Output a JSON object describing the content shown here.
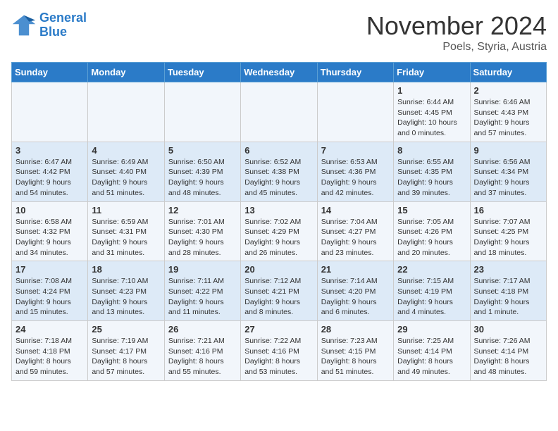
{
  "logo": {
    "line1": "General",
    "line2": "Blue"
  },
  "title": "November 2024",
  "subtitle": "Poels, Styria, Austria",
  "days_of_week": [
    "Sunday",
    "Monday",
    "Tuesday",
    "Wednesday",
    "Thursday",
    "Friday",
    "Saturday"
  ],
  "weeks": [
    [
      {
        "day": "",
        "info": ""
      },
      {
        "day": "",
        "info": ""
      },
      {
        "day": "",
        "info": ""
      },
      {
        "day": "",
        "info": ""
      },
      {
        "day": "",
        "info": ""
      },
      {
        "day": "1",
        "info": "Sunrise: 6:44 AM\nSunset: 4:45 PM\nDaylight: 10 hours and 0 minutes."
      },
      {
        "day": "2",
        "info": "Sunrise: 6:46 AM\nSunset: 4:43 PM\nDaylight: 9 hours and 57 minutes."
      }
    ],
    [
      {
        "day": "3",
        "info": "Sunrise: 6:47 AM\nSunset: 4:42 PM\nDaylight: 9 hours and 54 minutes."
      },
      {
        "day": "4",
        "info": "Sunrise: 6:49 AM\nSunset: 4:40 PM\nDaylight: 9 hours and 51 minutes."
      },
      {
        "day": "5",
        "info": "Sunrise: 6:50 AM\nSunset: 4:39 PM\nDaylight: 9 hours and 48 minutes."
      },
      {
        "day": "6",
        "info": "Sunrise: 6:52 AM\nSunset: 4:38 PM\nDaylight: 9 hours and 45 minutes."
      },
      {
        "day": "7",
        "info": "Sunrise: 6:53 AM\nSunset: 4:36 PM\nDaylight: 9 hours and 42 minutes."
      },
      {
        "day": "8",
        "info": "Sunrise: 6:55 AM\nSunset: 4:35 PM\nDaylight: 9 hours and 39 minutes."
      },
      {
        "day": "9",
        "info": "Sunrise: 6:56 AM\nSunset: 4:34 PM\nDaylight: 9 hours and 37 minutes."
      }
    ],
    [
      {
        "day": "10",
        "info": "Sunrise: 6:58 AM\nSunset: 4:32 PM\nDaylight: 9 hours and 34 minutes."
      },
      {
        "day": "11",
        "info": "Sunrise: 6:59 AM\nSunset: 4:31 PM\nDaylight: 9 hours and 31 minutes."
      },
      {
        "day": "12",
        "info": "Sunrise: 7:01 AM\nSunset: 4:30 PM\nDaylight: 9 hours and 28 minutes."
      },
      {
        "day": "13",
        "info": "Sunrise: 7:02 AM\nSunset: 4:29 PM\nDaylight: 9 hours and 26 minutes."
      },
      {
        "day": "14",
        "info": "Sunrise: 7:04 AM\nSunset: 4:27 PM\nDaylight: 9 hours and 23 minutes."
      },
      {
        "day": "15",
        "info": "Sunrise: 7:05 AM\nSunset: 4:26 PM\nDaylight: 9 hours and 20 minutes."
      },
      {
        "day": "16",
        "info": "Sunrise: 7:07 AM\nSunset: 4:25 PM\nDaylight: 9 hours and 18 minutes."
      }
    ],
    [
      {
        "day": "17",
        "info": "Sunrise: 7:08 AM\nSunset: 4:24 PM\nDaylight: 9 hours and 15 minutes."
      },
      {
        "day": "18",
        "info": "Sunrise: 7:10 AM\nSunset: 4:23 PM\nDaylight: 9 hours and 13 minutes."
      },
      {
        "day": "19",
        "info": "Sunrise: 7:11 AM\nSunset: 4:22 PM\nDaylight: 9 hours and 11 minutes."
      },
      {
        "day": "20",
        "info": "Sunrise: 7:12 AM\nSunset: 4:21 PM\nDaylight: 9 hours and 8 minutes."
      },
      {
        "day": "21",
        "info": "Sunrise: 7:14 AM\nSunset: 4:20 PM\nDaylight: 9 hours and 6 minutes."
      },
      {
        "day": "22",
        "info": "Sunrise: 7:15 AM\nSunset: 4:19 PM\nDaylight: 9 hours and 4 minutes."
      },
      {
        "day": "23",
        "info": "Sunrise: 7:17 AM\nSunset: 4:18 PM\nDaylight: 9 hours and 1 minute."
      }
    ],
    [
      {
        "day": "24",
        "info": "Sunrise: 7:18 AM\nSunset: 4:18 PM\nDaylight: 8 hours and 59 minutes."
      },
      {
        "day": "25",
        "info": "Sunrise: 7:19 AM\nSunset: 4:17 PM\nDaylight: 8 hours and 57 minutes."
      },
      {
        "day": "26",
        "info": "Sunrise: 7:21 AM\nSunset: 4:16 PM\nDaylight: 8 hours and 55 minutes."
      },
      {
        "day": "27",
        "info": "Sunrise: 7:22 AM\nSunset: 4:16 PM\nDaylight: 8 hours and 53 minutes."
      },
      {
        "day": "28",
        "info": "Sunrise: 7:23 AM\nSunset: 4:15 PM\nDaylight: 8 hours and 51 minutes."
      },
      {
        "day": "29",
        "info": "Sunrise: 7:25 AM\nSunset: 4:14 PM\nDaylight: 8 hours and 49 minutes."
      },
      {
        "day": "30",
        "info": "Sunrise: 7:26 AM\nSunset: 4:14 PM\nDaylight: 8 hours and 48 minutes."
      }
    ]
  ]
}
